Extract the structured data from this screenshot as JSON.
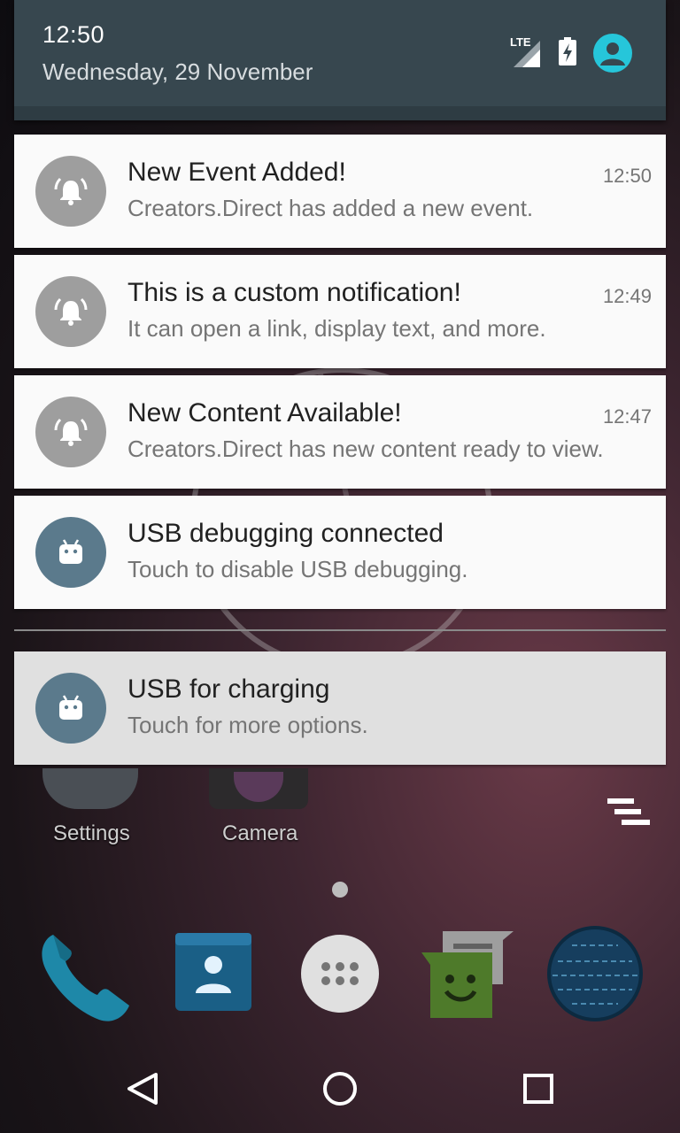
{
  "header": {
    "time": "12:50",
    "date": "Wednesday, 29 November",
    "network_label": "LTE",
    "icons": [
      "lte-signal-icon",
      "battery-charging-icon",
      "user-avatar-icon"
    ]
  },
  "notifications": [
    {
      "title": "New Event Added!",
      "text": "Creators.Direct has added a new event.",
      "time": "12:50",
      "icon": "bell-ring-icon"
    },
    {
      "title": "This is a custom notification!",
      "text": "It can open a link, display text, and more.",
      "time": "12:49",
      "icon": "bell-ring-icon"
    },
    {
      "title": "New Content Available!",
      "text": "Creators.Direct has new content ready to view.",
      "time": "12:47",
      "icon": "bell-ring-icon"
    },
    {
      "title": "USB debugging connected",
      "text": "Touch to disable USB debugging.",
      "time": "",
      "icon": "android-icon"
    },
    {
      "title": "USB for charging",
      "text": "Touch for more options.",
      "time": "",
      "icon": "android-icon"
    }
  ],
  "home": {
    "apps": [
      "Settings",
      "Camera"
    ],
    "dock": [
      "phone-icon",
      "contacts-icon",
      "app-drawer-icon",
      "messenger-icon",
      "browser-globe-icon"
    ]
  },
  "navbar": [
    "back-icon",
    "home-icon",
    "recents-icon"
  ],
  "colors": {
    "header_bg": "#37474f",
    "card_bg": "#fafafa",
    "highlight_card_bg": "#e0e0e0",
    "bell_circle": "#9e9e9e",
    "android_circle": "#5b7a8c",
    "avatar": "#26c6da"
  }
}
